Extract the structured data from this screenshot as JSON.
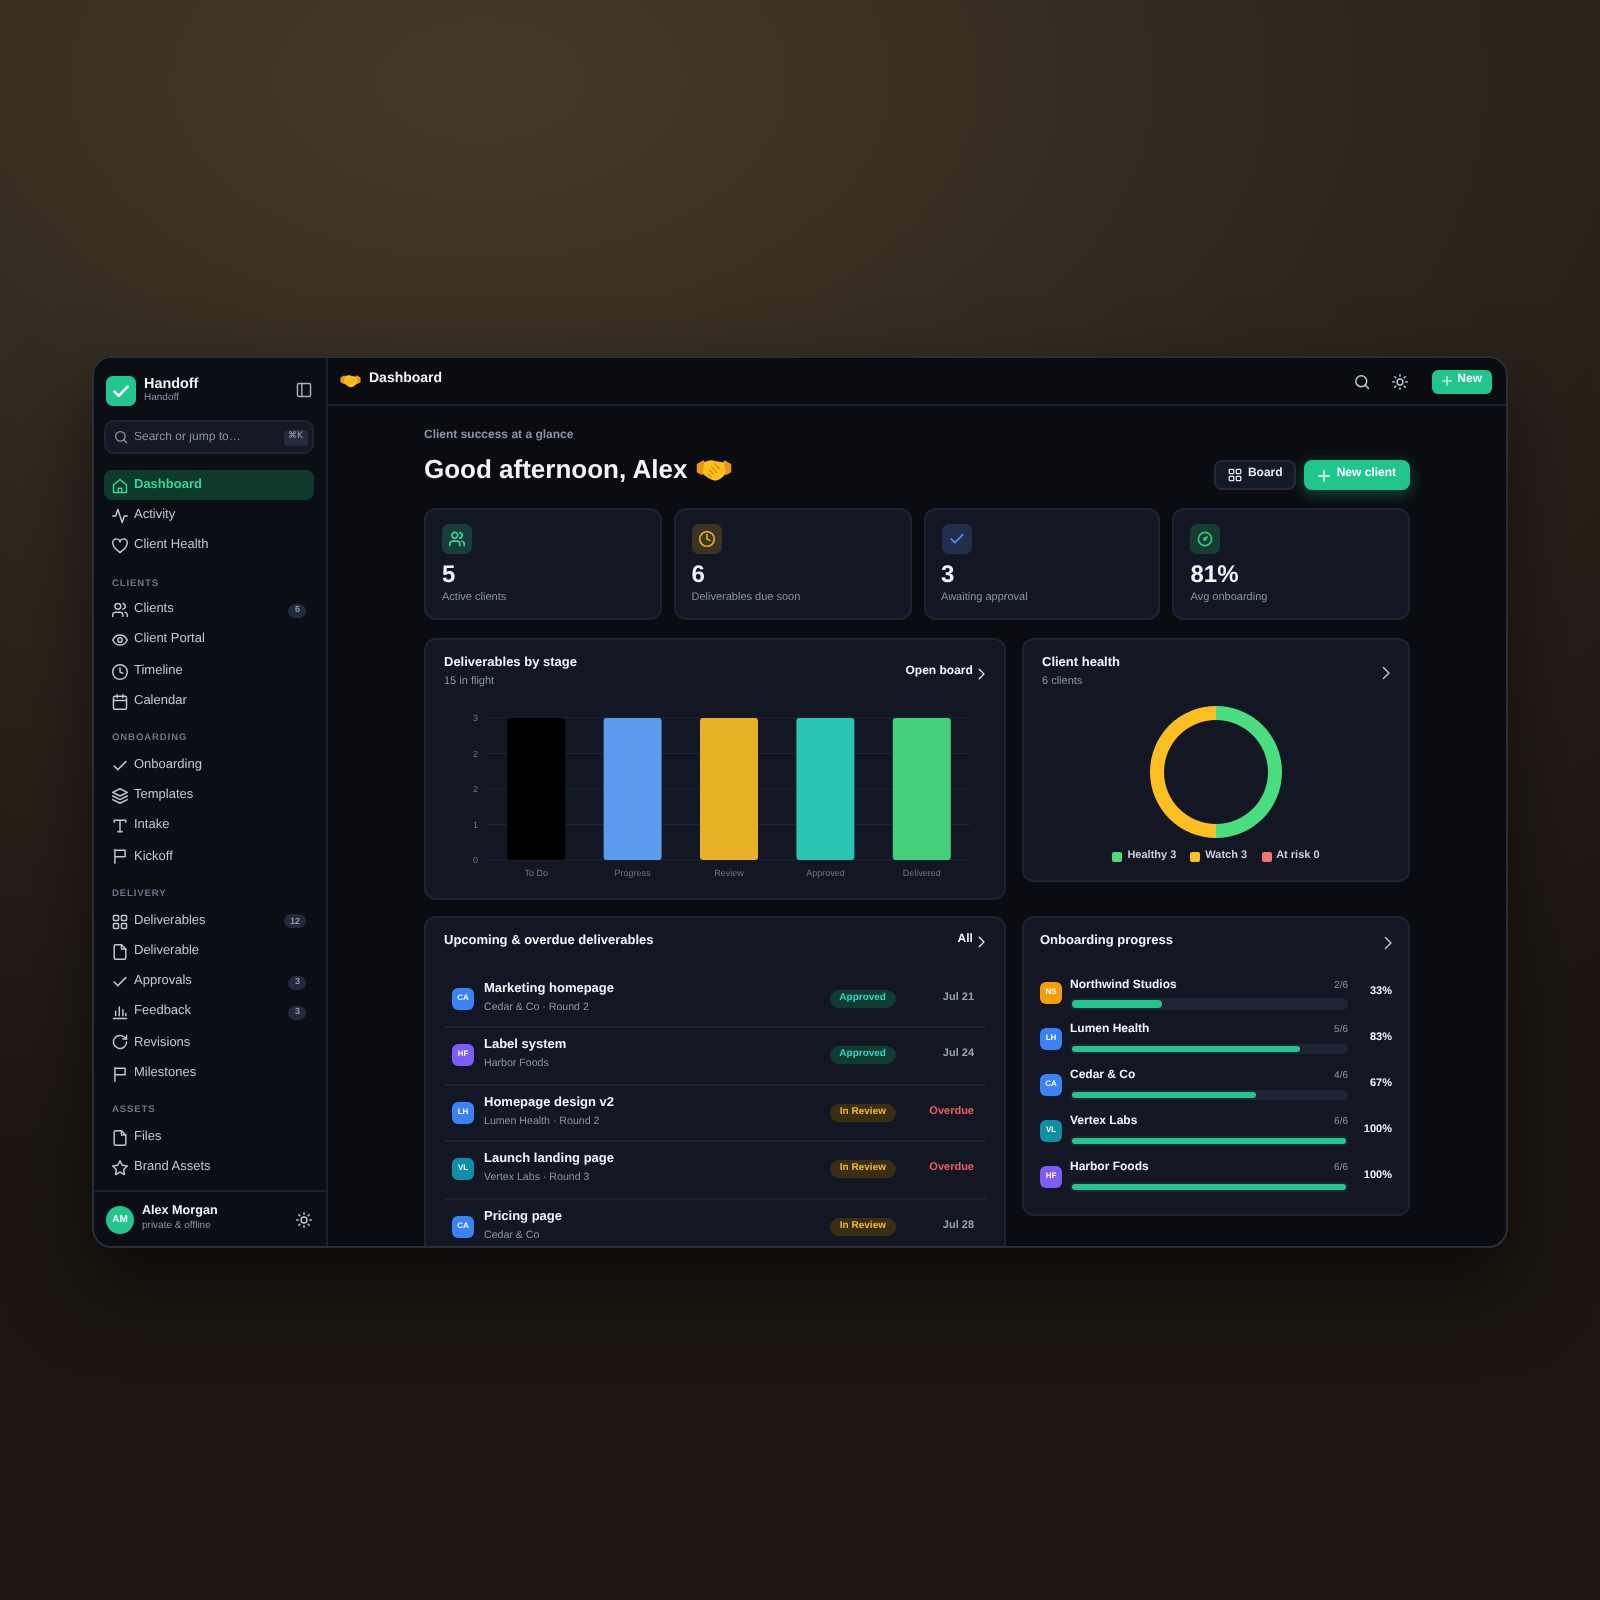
{
  "sidebar": {
    "brand": {
      "name": "Handoff",
      "subtitle": "Handoff"
    },
    "search": {
      "placeholder": "Search or jump to…",
      "shortcut": "⌘K"
    },
    "sections": [
      {
        "items": [
          {
            "label": "Dashboard",
            "selected": true
          },
          {
            "label": "Activity",
            "selected": false
          },
          {
            "label": "Client Health",
            "selected": false
          }
        ]
      },
      {
        "heading": "CLIENTS",
        "items": [
          {
            "label": "Clients",
            "selected": false,
            "count": "6"
          },
          {
            "label": "Client Portal",
            "selected": false
          },
          {
            "label": "Timeline",
            "selected": false
          },
          {
            "label": "Calendar",
            "selected": false
          }
        ]
      },
      {
        "heading": "ONBOARDING",
        "items": [
          {
            "label": "Onboarding",
            "selected": false
          },
          {
            "label": "Templates",
            "selected": false
          },
          {
            "label": "Intake",
            "selected": false
          },
          {
            "label": "Kickoff",
            "selected": false
          }
        ]
      },
      {
        "heading": "DELIVERY",
        "items": [
          {
            "label": "Deliverables",
            "selected": false,
            "count": "12"
          },
          {
            "label": "Deliverable",
            "selected": false
          },
          {
            "label": "Approvals",
            "selected": false,
            "count": "3"
          },
          {
            "label": "Feedback",
            "selected": false,
            "count": "3"
          },
          {
            "label": "Revisions",
            "selected": false
          },
          {
            "label": "Milestones",
            "selected": false
          }
        ]
      },
      {
        "heading": "ASSETS",
        "items": [
          {
            "label": "Files",
            "selected": false
          },
          {
            "label": "Brand Assets",
            "selected": false
          }
        ]
      }
    ],
    "user": {
      "initials": "AM",
      "name": "Alex Morgan",
      "status": "private & offline"
    }
  },
  "topbar": {
    "title": "Dashboard",
    "button": "New"
  },
  "header": {
    "eyebrow": "Client success at a glance",
    "greeting": "Good afternoon, Alex",
    "buttons": [
      {
        "label": "Board",
        "kind": "secondary"
      },
      {
        "label": "New client",
        "kind": "primary"
      }
    ]
  },
  "stats": [
    {
      "value": "5",
      "label": "Active clients",
      "color": "#1a3d3b"
    },
    {
      "value": "6",
      "label": "Deliverables due soon",
      "color": "#3c3423"
    },
    {
      "value": "3",
      "label": "Awaiting approval",
      "color": "#212f4d"
    },
    {
      "value": "81%",
      "label": "Avg onboarding",
      "color": "#183b33"
    }
  ],
  "stage_chart": {
    "title": "Deliverables by stage",
    "subtitle": "15 in flight",
    "link": "Open board",
    "chart_data": {
      "type": "bar",
      "categories": [
        "To Do",
        "Progress",
        "Review",
        "Approved",
        "Delivered"
      ],
      "values": [
        3,
        3,
        3,
        3,
        3
      ],
      "colors": [
        "#000000",
        "#5b9bec",
        "#e8b026",
        "#2ac4b3",
        "#46cf7b"
      ],
      "ylim": [
        0,
        3
      ],
      "yticks": [
        {
          "value": 3,
          "label": "3"
        },
        {
          "value": 2.25,
          "label": "2"
        },
        {
          "value": 1.5,
          "label": "2"
        },
        {
          "value": 0.75,
          "label": "1"
        },
        {
          "value": 0,
          "label": "0"
        }
      ],
      "grid": true
    }
  },
  "client_health": {
    "title": "Client health",
    "subtitle": "6 clients",
    "chart_data": {
      "type": "donut",
      "values": [
        50,
        50,
        0
      ]
    },
    "legend": [
      {
        "label": "Healthy 3",
        "color": "#4ade80"
      },
      {
        "label": "Watch 3",
        "color": "#fbbf24"
      },
      {
        "label": "At risk 0",
        "color": "#f87171"
      }
    ]
  },
  "deliverables": {
    "title": "Upcoming & overdue deliverables",
    "link": "All",
    "items": [
      {
        "initials": "CA",
        "color": "#3b82f6",
        "title": "Marketing homepage",
        "subtitle": "Cedar & Co · Round 2",
        "status": {
          "label": "Approved",
          "kind": "approved"
        },
        "due": "Jul 21",
        "overdue": false
      },
      {
        "initials": "HF",
        "color": "#7c5cf5",
        "title": "Label system",
        "subtitle": "Harbor Foods",
        "status": {
          "label": "Approved",
          "kind": "approved"
        },
        "due": "Jul 24",
        "overdue": false
      },
      {
        "initials": "LH",
        "color": "#3b82f6",
        "title": "Homepage design v2",
        "subtitle": "Lumen Health · Round 2",
        "status": {
          "label": "In Review",
          "kind": "review"
        },
        "due": "Overdue",
        "overdue": true
      },
      {
        "initials": "VL",
        "color": "#0e8fa8",
        "title": "Launch landing page",
        "subtitle": "Vertex Labs · Round 3",
        "status": {
          "label": "In Review",
          "kind": "review"
        },
        "due": "Overdue",
        "overdue": true
      },
      {
        "initials": "CA",
        "color": "#3b82f6",
        "title": "Pricing page",
        "subtitle": "Cedar & Co",
        "status": {
          "label": "In Review",
          "kind": "review"
        },
        "due": "Jul 28",
        "overdue": false
      }
    ]
  },
  "onboarding": {
    "title": "Onboarding progress",
    "clients": [
      {
        "initials": "NS",
        "color": "#f59e0b",
        "name": "Northwind Studios",
        "steps": "2/6",
        "level": 0.33,
        "percent": "33%"
      },
      {
        "initials": "LH",
        "color": "#3b82f6",
        "name": "Lumen Health",
        "steps": "5/6",
        "level": 0.83,
        "percent": "83%"
      },
      {
        "initials": "CA",
        "color": "#3b82f6",
        "name": "Cedar & Co",
        "steps": "4/6",
        "level": 0.67,
        "percent": "67%"
      },
      {
        "initials": "VL",
        "color": "#0e8fa8",
        "name": "Vertex Labs",
        "steps": "6/6",
        "level": 1,
        "percent": "100%"
      },
      {
        "initials": "HF",
        "color": "#7c5cf5",
        "name": "Harbor Foods",
        "steps": "6/6",
        "level": 1,
        "percent": "100%"
      }
    ]
  }
}
